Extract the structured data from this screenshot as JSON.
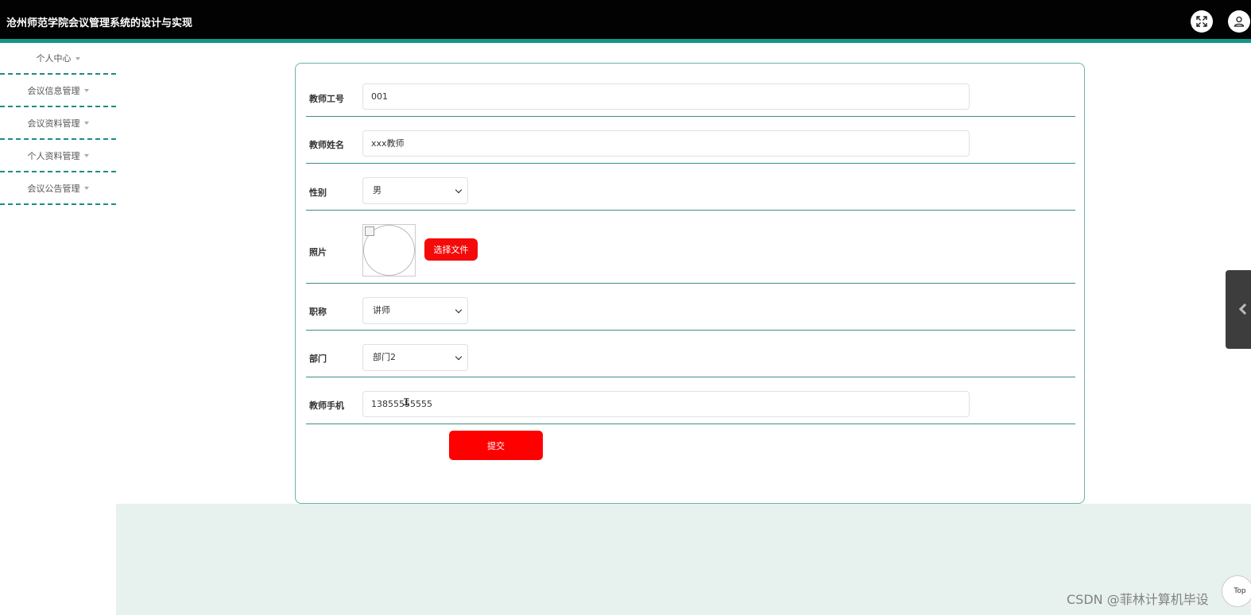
{
  "header": {
    "title": "沧州师范学院会议管理系统的设计与实现",
    "icons": {
      "fullscreen": "fullscreen-icon",
      "user": "user-icon"
    }
  },
  "sidebar": {
    "items": [
      {
        "label": "个人中心"
      },
      {
        "label": "会议信息管理"
      },
      {
        "label": "会议资料管理"
      },
      {
        "label": "个人资料管理"
      },
      {
        "label": "会议公告管理"
      }
    ]
  },
  "form": {
    "teacher_id": {
      "label": "教师工号",
      "value": "001"
    },
    "teacher_name": {
      "label": "教师姓名",
      "value": "xxx教师"
    },
    "gender": {
      "label": "性别",
      "value": "男"
    },
    "photo": {
      "label": "照片",
      "button": "选择文件"
    },
    "title_rank": {
      "label": "职称",
      "value": "讲师"
    },
    "department": {
      "label": "部门",
      "value": "部门2"
    },
    "phone": {
      "label": "教师手机",
      "value": "13855555555"
    },
    "submit": "提交"
  },
  "floating": {
    "top": "Top"
  },
  "watermark": "CSDN @菲林计算机毕设",
  "colors": {
    "header_bg": "#020202",
    "header_accent": "#12968b",
    "primary_button": "#fe0000",
    "bottom_bg": "#e7f1ed",
    "row_divider": "#3d8d85"
  }
}
